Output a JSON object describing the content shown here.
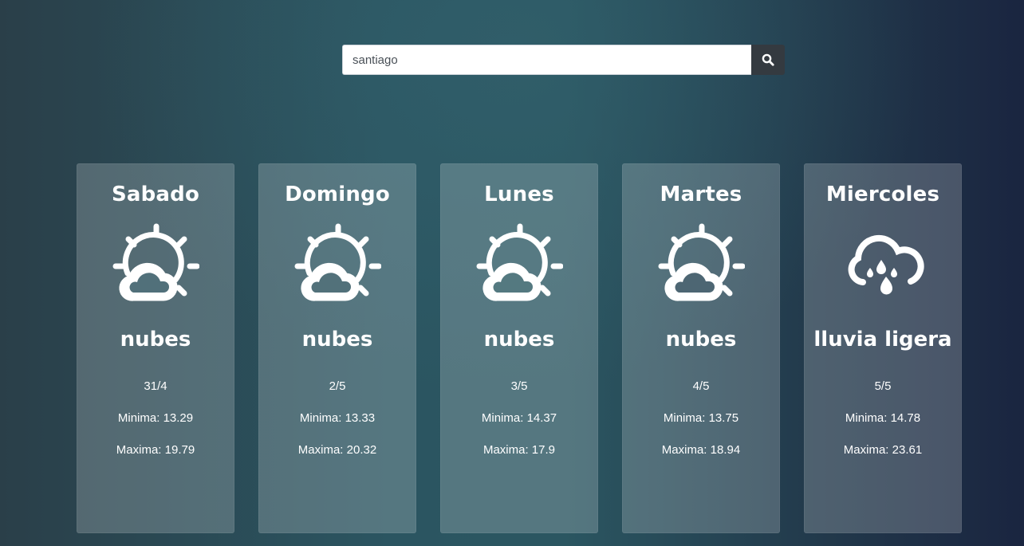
{
  "search": {
    "value": "santiago",
    "button_icon": "search-icon"
  },
  "forecast": [
    {
      "day": "Sabado",
      "icon": "partly-cloudy-icon",
      "description": "nubes",
      "date": "31/4",
      "min": "Minima: 13.29",
      "max": "Maxima: 19.79"
    },
    {
      "day": "Domingo",
      "icon": "partly-cloudy-icon",
      "description": "nubes",
      "date": "2/5",
      "min": "Minima: 13.33",
      "max": "Maxima: 20.32"
    },
    {
      "day": "Lunes",
      "icon": "partly-cloudy-icon",
      "description": "nubes",
      "date": "3/5",
      "min": "Minima: 14.37",
      "max": "Maxima: 17.9"
    },
    {
      "day": "Martes",
      "icon": "partly-cloudy-icon",
      "description": "nubes",
      "date": "4/5",
      "min": "Minima: 13.75",
      "max": "Maxima: 18.94"
    },
    {
      "day": "Miercoles",
      "icon": "rain-cloud-icon",
      "description": "lluvia ligera",
      "date": "5/5",
      "min": "Minima: 14.78",
      "max": "Maxima: 23.61"
    }
  ],
  "colors": {
    "search_button": "#343a40",
    "text": "#ffffff"
  }
}
